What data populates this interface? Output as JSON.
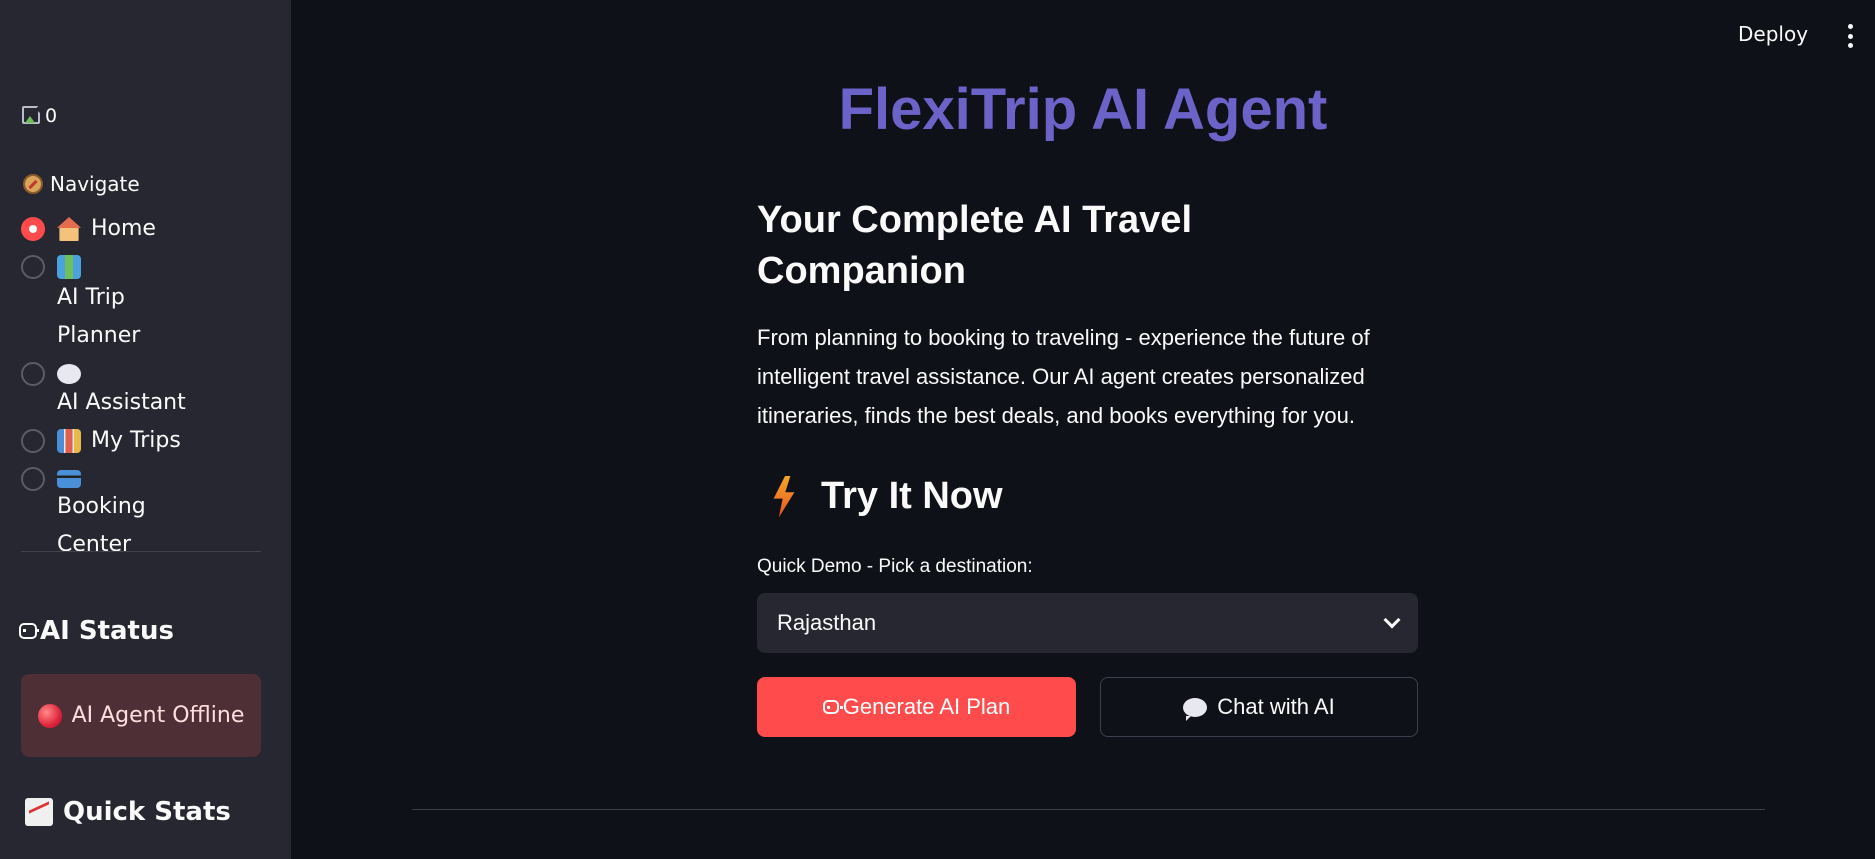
{
  "topbar": {
    "deploy_label": "Deploy",
    "menu_icon": "more-vert-icon"
  },
  "sidebar": {
    "logo_alt": "0",
    "nav_label": "Navigate",
    "nav_items": [
      {
        "label": "Home",
        "icon": "house-icon",
        "selected": true
      },
      {
        "label": "AI Trip Planner",
        "icon": "map-icon",
        "selected": false
      },
      {
        "label": "AI Assistant",
        "icon": "speech-icon",
        "selected": false
      },
      {
        "label": "My Trips",
        "icon": "chart-icon",
        "selected": false
      },
      {
        "label": "Booking Center",
        "icon": "card-icon",
        "selected": false
      }
    ],
    "ai_status_title": "AI Status",
    "ai_status_text": "AI Agent Offline",
    "quick_stats_title": "Quick Stats"
  },
  "main": {
    "title": "FlexiTrip AI Agent",
    "hero_heading": "Your Complete AI Travel Companion",
    "hero_desc": "From planning to booking to traveling - experience the future of intelligent travel assistance. Our AI agent creates personalized itineraries, finds the best deals, and books everything for you.",
    "try_title": "Try It Now",
    "select_label": "Quick Demo - Pick a destination:",
    "select_value": "Rajasthan",
    "generate_button": "Generate AI Plan",
    "chat_button": "Chat with AI"
  },
  "colors": {
    "accent": "#ff4b4b",
    "title": "#6c63c9",
    "background": "#0e1117",
    "sidebar": "#262730",
    "status_offline_bg": "#4e2f35"
  }
}
